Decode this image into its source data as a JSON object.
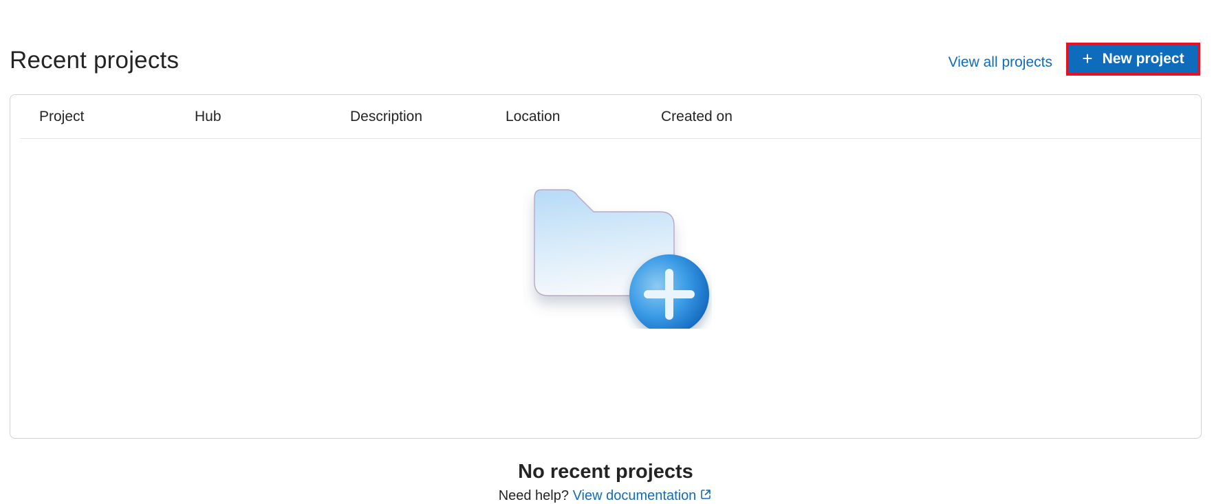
{
  "header": {
    "title": "Recent projects",
    "view_all_label": "View all projects",
    "new_project_label": "New project",
    "new_project_icon": "plus-icon"
  },
  "table": {
    "columns": [
      "Project",
      "Hub",
      "Description",
      "Location",
      "Created on"
    ]
  },
  "empty_state": {
    "illustration": "folder-add-icon",
    "title": "No recent projects",
    "help_prefix": "Need help?",
    "help_link_label": "View documentation",
    "help_link_icon": "external-link-icon"
  },
  "colors": {
    "accent": "#0f6cbd",
    "highlight_border": "#e81123",
    "text": "#242424",
    "border": "#d1d1d1"
  }
}
